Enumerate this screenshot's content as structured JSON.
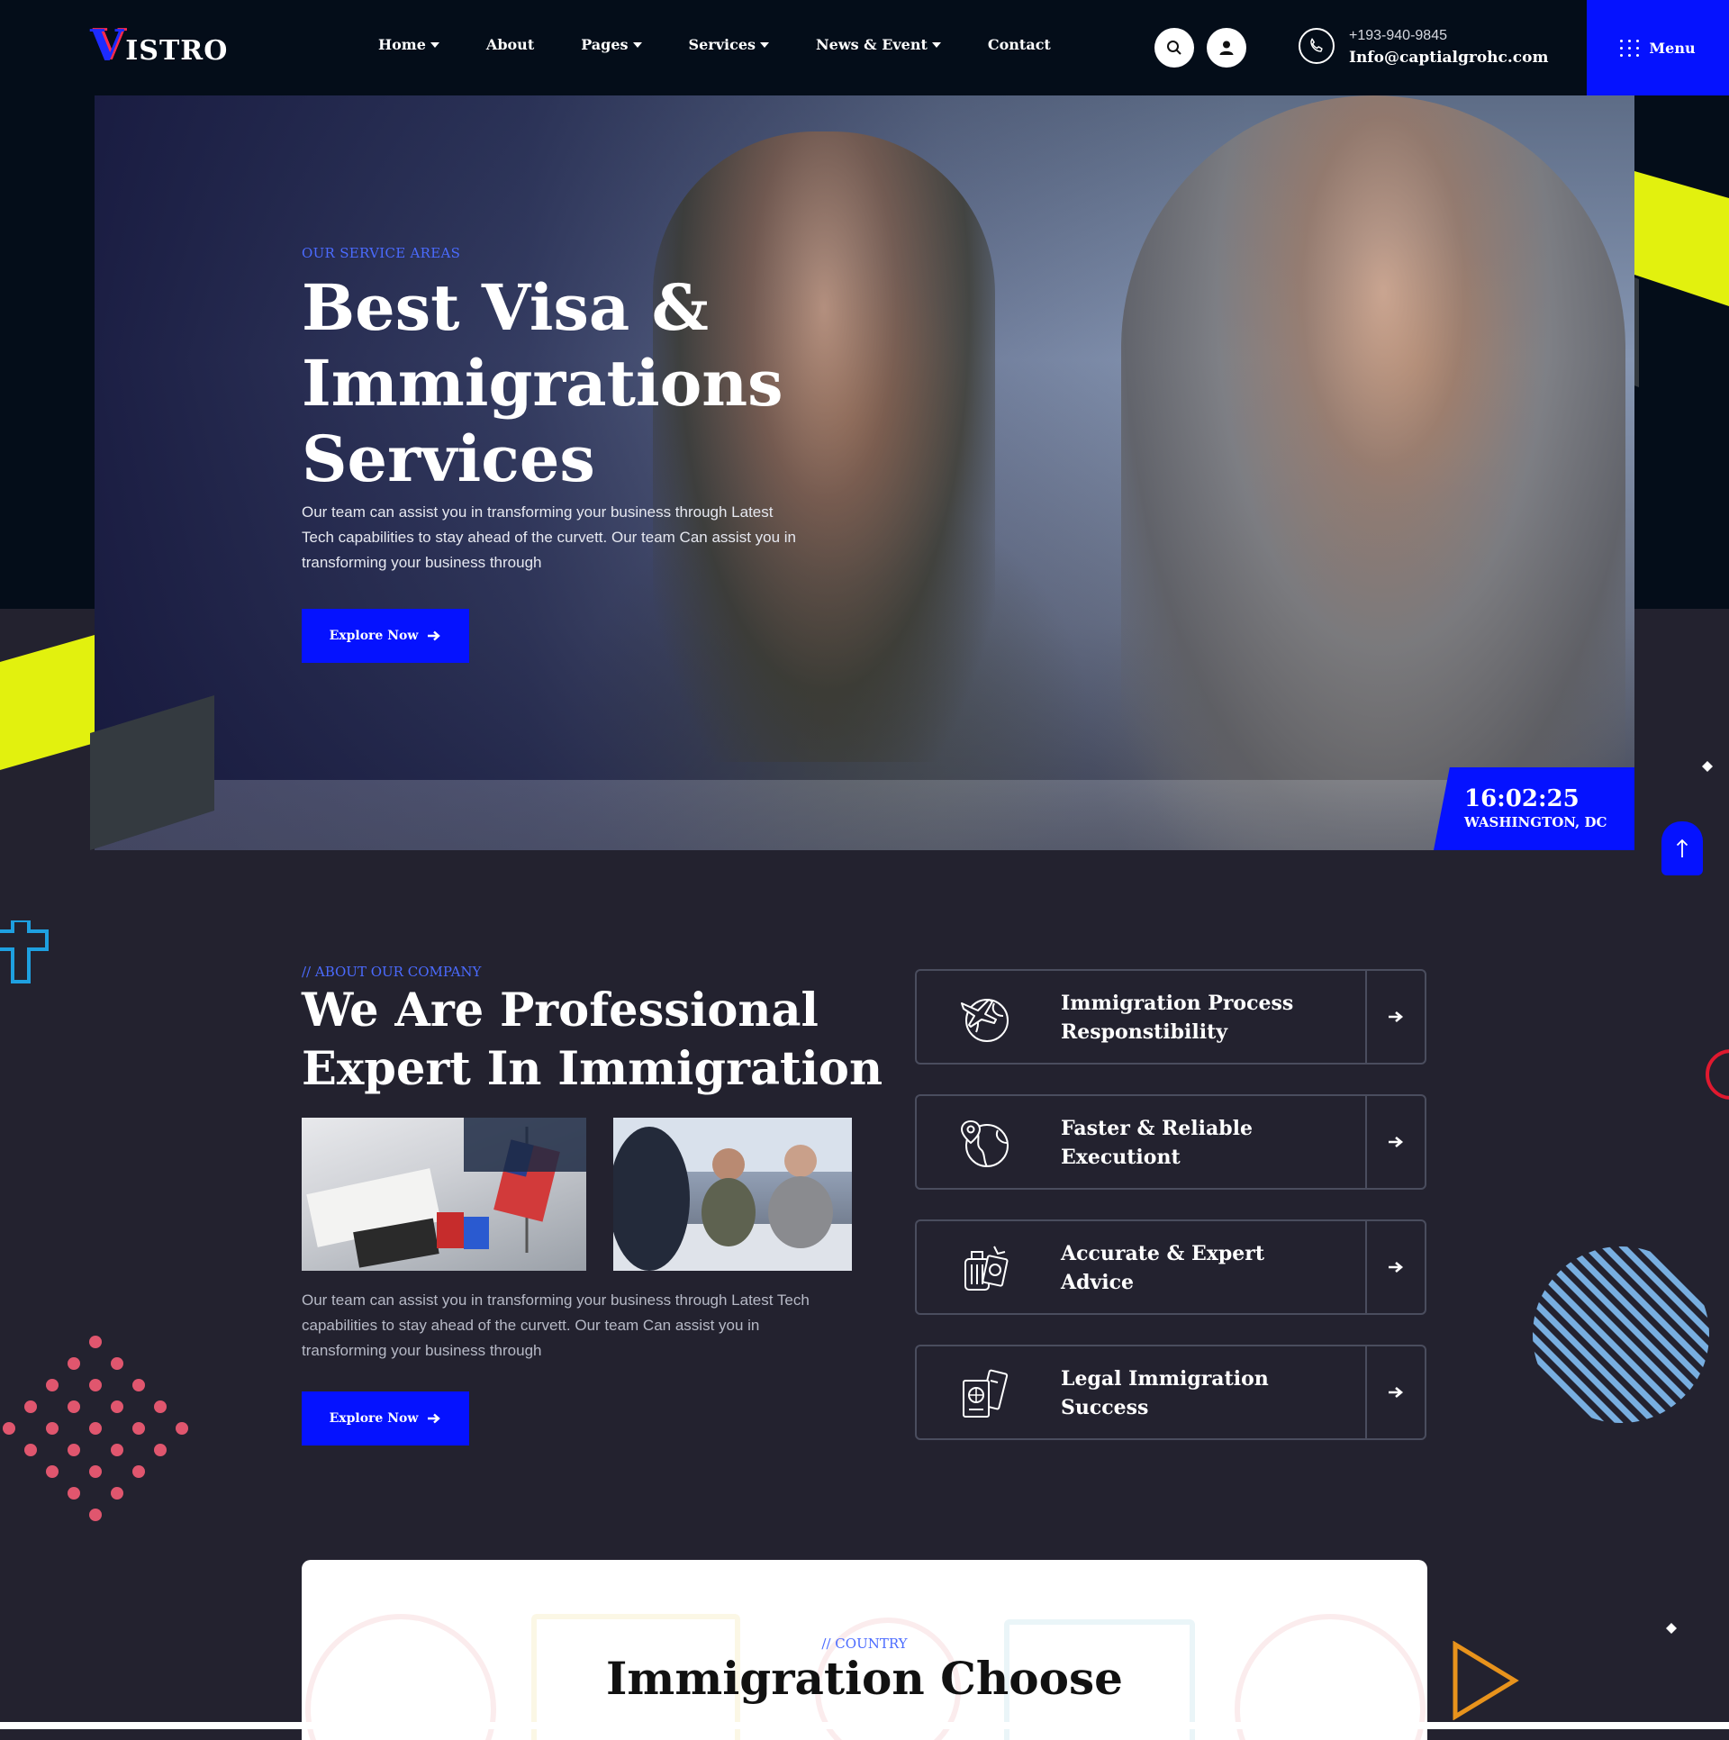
{
  "colors": {
    "accent": "#0512ff",
    "eyebrow": "#4b6bff",
    "dark_bg": "#040d19",
    "section_bg": "#23222f",
    "yellow": "#e2f10e",
    "pink": "#e0566e"
  },
  "header": {
    "logo_v": "V",
    "logo_rest": "ISTRO",
    "nav": [
      {
        "label": "Home",
        "dropdown": true
      },
      {
        "label": "About",
        "dropdown": false
      },
      {
        "label": "Pages",
        "dropdown": true
      },
      {
        "label": "Services",
        "dropdown": true
      },
      {
        "label": "News & Event",
        "dropdown": true
      },
      {
        "label": "Contact",
        "dropdown": false
      }
    ],
    "search_icon": "search-icon",
    "user_icon": "user-icon",
    "phone": "+193-940-9845",
    "email": "Info@captialgrohc.com",
    "menu_label": "Menu"
  },
  "hero": {
    "eyebrow": "OUR SERVICE AREAS",
    "title_lines": [
      "Best Visa &",
      "Immigrations",
      "Services"
    ],
    "description": "Our team can assist you in transforming your business through Latest Tech capabilities to stay ahead of the curvett. Our team Can assist you in transforming your business through",
    "button_label": "Explore Now",
    "clock_time": "16:02:25",
    "clock_city": "WASHINGTON, DC"
  },
  "about": {
    "eyebrow": "// ABOUT OUR COMPANY",
    "title_lines": [
      "We Are Professional",
      "Expert In Immigration"
    ],
    "description": "Our team can assist you in transforming your business through Latest Tech capabilities to stay ahead of the curvett. Our team Can assist you in transforming your business through",
    "button_label": "Explore Now",
    "features": [
      {
        "lines": [
          "Immigration Process",
          "Responstibility"
        ],
        "icon": "globe-plane-icon"
      },
      {
        "lines": [
          "Faster & Reliable",
          "Executiont"
        ],
        "icon": "globe-pin-icon"
      },
      {
        "lines": [
          "Accurate & Expert",
          "Advice"
        ],
        "icon": "luggage-passport-icon"
      },
      {
        "lines": [
          "Legal Immigration",
          "Success"
        ],
        "icon": "passport-ticket-icon"
      }
    ]
  },
  "country": {
    "eyebrow": "// COUNTRY",
    "title": "Immigration Choose"
  }
}
